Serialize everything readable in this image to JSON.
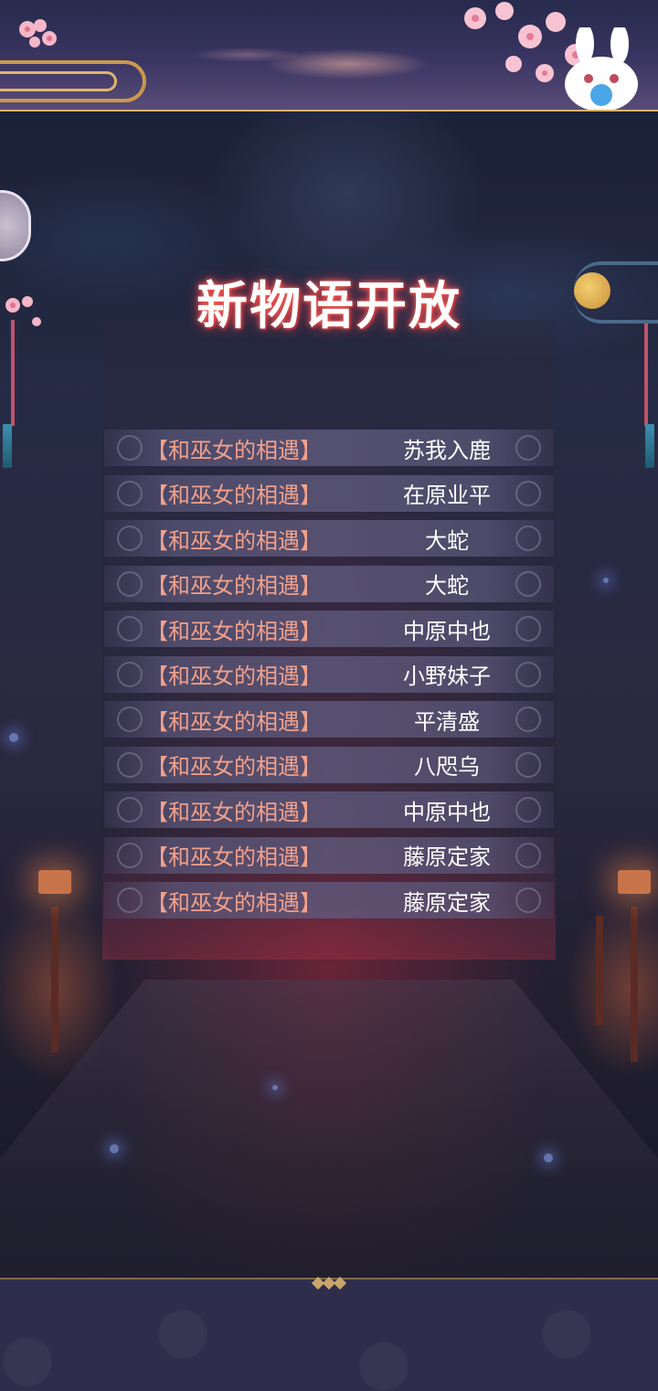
{
  "title": "新物语开放",
  "list": [
    {
      "event": "【和巫女的相遇】",
      "name": "苏我入鹿"
    },
    {
      "event": "【和巫女的相遇】",
      "name": "在原业平"
    },
    {
      "event": "【和巫女的相遇】",
      "name": "大蛇"
    },
    {
      "event": "【和巫女的相遇】",
      "name": "大蛇"
    },
    {
      "event": "【和巫女的相遇】",
      "name": "中原中也"
    },
    {
      "event": "【和巫女的相遇】",
      "name": "小野妹子"
    },
    {
      "event": "【和巫女的相遇】",
      "name": "平清盛"
    },
    {
      "event": "【和巫女的相遇】",
      "name": "八咫乌"
    },
    {
      "event": "【和巫女的相遇】",
      "name": "中原中也"
    },
    {
      "event": "【和巫女的相遇】",
      "name": "藤原定家"
    },
    {
      "event": "【和巫女的相遇】",
      "name": "藤原定家"
    }
  ],
  "icons": {
    "back": "back-disc-icon",
    "mascot": "rabbit-mascot-icon",
    "blossom": "cherry-blossom-icon",
    "moon": "moon-icon"
  },
  "colors": {
    "event_text": "#f2a08a",
    "name_text": "#ffffff",
    "title_glow": "#e0384a",
    "gold": "#d9b46a"
  }
}
